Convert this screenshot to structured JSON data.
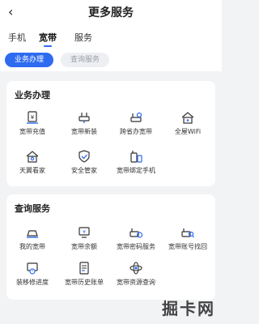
{
  "header": {
    "title": "更多服务"
  },
  "tabs": [
    {
      "label": "手机"
    },
    {
      "label": "宽带",
      "active": true
    },
    {
      "label": "服务"
    }
  ],
  "chips": [
    {
      "label": "业务办理",
      "active": true
    },
    {
      "label": "查询服务",
      "active": false
    }
  ],
  "sections": [
    {
      "title": "业务办理",
      "items": [
        {
          "label": "宽带充值",
          "icon": "broadband-recharge-icon"
        },
        {
          "label": "宽带新装",
          "icon": "broadband-install-icon"
        },
        {
          "label": "跨省办宽带",
          "icon": "cross-province-broadband-icon"
        },
        {
          "label": "全屋WiFi",
          "icon": "whole-house-wifi-icon"
        },
        {
          "label": "天翼看家",
          "icon": "home-camera-icon"
        },
        {
          "label": "安全管家",
          "icon": "security-shield-icon"
        },
        {
          "label": "宽带绑定手机",
          "icon": "bind-phone-icon"
        }
      ]
    },
    {
      "title": "查询服务",
      "items": [
        {
          "label": "我的宽带",
          "icon": "my-broadband-icon"
        },
        {
          "label": "宽带余额",
          "icon": "broadband-balance-icon"
        },
        {
          "label": "宽带密码服务",
          "icon": "broadband-password-icon"
        },
        {
          "label": "宽带账号找回",
          "icon": "account-recovery-icon"
        },
        {
          "label": "装移修进度",
          "icon": "install-progress-icon"
        },
        {
          "label": "宽带历史账单",
          "icon": "history-bill-icon"
        },
        {
          "label": "宽带资源查询",
          "icon": "resource-query-icon"
        }
      ]
    }
  ],
  "watermark": "掘卡网",
  "colors": {
    "accent": "#2e6bf0",
    "background": "#f2f3f5"
  }
}
